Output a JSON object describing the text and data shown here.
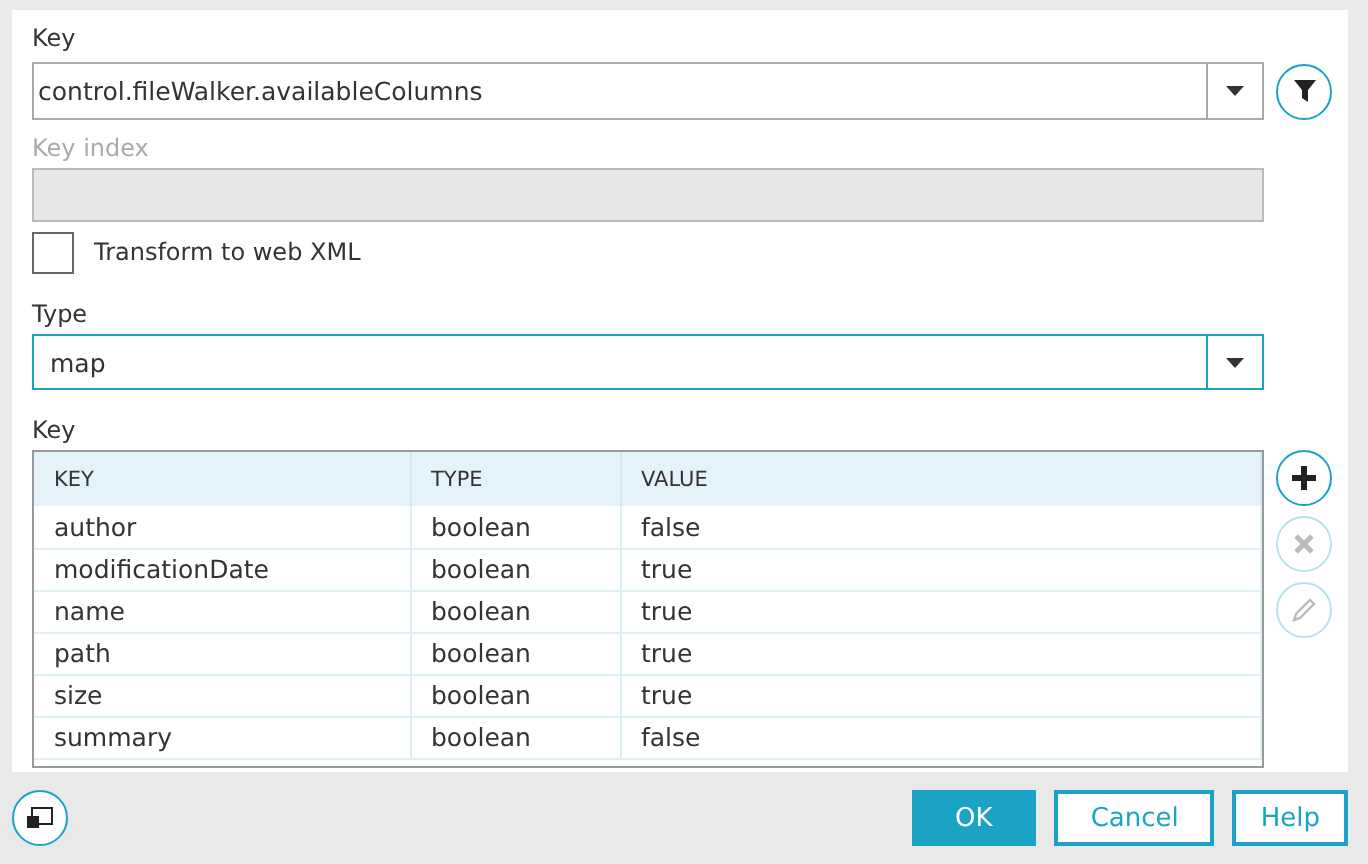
{
  "key_field": {
    "label": "Key",
    "value": "control.fileWalker.availableColumns",
    "focused": false
  },
  "key_index": {
    "label": "Key index",
    "disabled": true
  },
  "transform": {
    "label": "Transform to web XML",
    "checked": false
  },
  "type_field": {
    "label": "Type",
    "value": "map",
    "focused": true
  },
  "table": {
    "label": "Key",
    "columns": [
      "KEY",
      "TYPE",
      "VALUE"
    ],
    "rows": [
      [
        "author",
        "boolean",
        "false"
      ],
      [
        "modificationDate",
        "boolean",
        "true"
      ],
      [
        "name",
        "boolean",
        "true"
      ],
      [
        "path",
        "boolean",
        "true"
      ],
      [
        "size",
        "boolean",
        "true"
      ],
      [
        "summary",
        "boolean",
        "false"
      ]
    ]
  },
  "side_buttons": [
    {
      "kind": "add",
      "disabled": false
    },
    {
      "kind": "remove",
      "disabled": true
    },
    {
      "kind": "edit",
      "disabled": true
    }
  ],
  "buttons": [
    {
      "label": "OK",
      "kind": "primary"
    },
    {
      "label": "Cancel",
      "kind": "secondary"
    },
    {
      "label": "Help",
      "kind": "secondary"
    }
  ]
}
